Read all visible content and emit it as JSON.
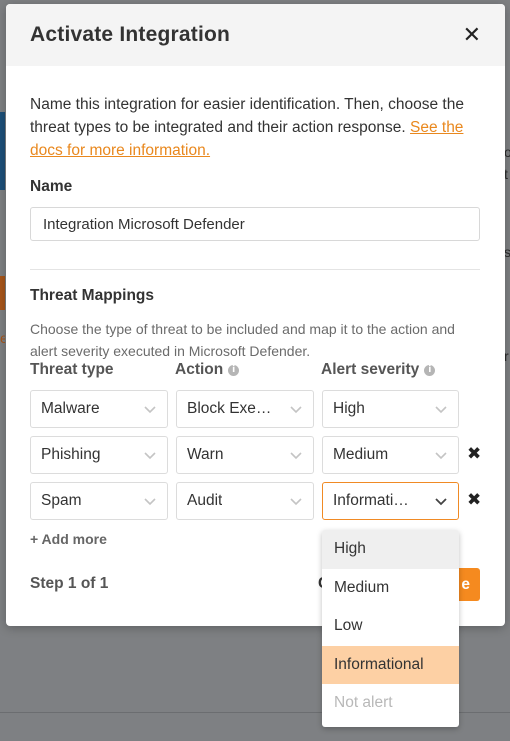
{
  "background": {
    "right_fragments": [
      "o",
      "t",
      "s",
      "r"
    ],
    "left_link_fragment": "e"
  },
  "modal": {
    "title": "Activate Integration",
    "close_glyph": "✕",
    "intro_text": "Name this integration for easier identification. Then, choose the threat types to be integrated and their action response. ",
    "intro_link": "See the docs for more information.",
    "name_label": "Name",
    "name_value": "Integration Microsoft Defender",
    "section_title": "Threat Mappings",
    "section_desc": "Choose the type of threat to be included and map it to the action and alert severity executed in Microsoft Defender.",
    "headers": {
      "threat_type": "Threat type",
      "action": "Action",
      "alert_severity": "Alert severity",
      "info_glyph": "i"
    },
    "rows": [
      {
        "threat": "Malware",
        "action": "Block Exe…",
        "severity": "High",
        "removable": false
      },
      {
        "threat": "Phishing",
        "action": "Warn",
        "severity": "Medium",
        "removable": true
      },
      {
        "threat": "Spam",
        "action": "Audit",
        "severity": "Informati…",
        "removable": true
      }
    ],
    "remove_glyph": "✖",
    "add_more": "+ Add more",
    "step": "Step 1 of 1",
    "cancel_label": "C",
    "next_label": "e",
    "dropdown_options": [
      "High",
      "Medium",
      "Low",
      "Informational",
      "Not alert"
    ],
    "dropdown_selected": "Informational",
    "dropdown_hover": "High",
    "dropdown_disabled": "Not alert"
  },
  "colors": {
    "accent": "#f58a1f",
    "link": "#e9881e",
    "selected_option": "#fdd0a4"
  }
}
